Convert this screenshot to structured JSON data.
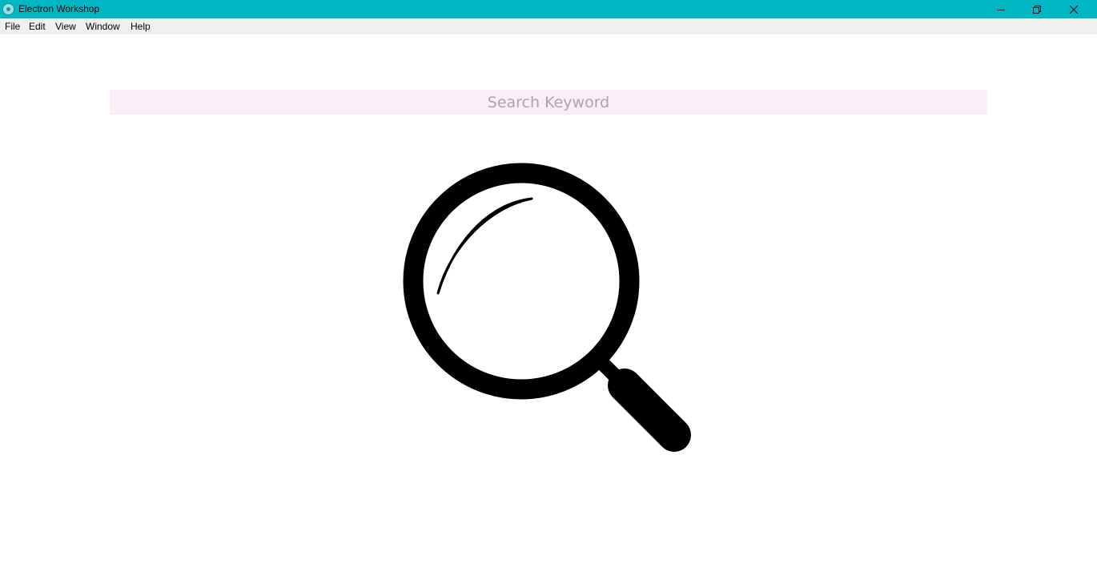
{
  "window": {
    "title": "Electron Workshop",
    "title_bar_color": "#00b7c3",
    "controls": [
      "minimize-icon",
      "restore-icon",
      "close-icon"
    ]
  },
  "menu": {
    "items": [
      {
        "label": "File"
      },
      {
        "label": "Edit"
      },
      {
        "label": "View"
      },
      {
        "label": "Window"
      },
      {
        "label": "Help"
      }
    ]
  },
  "search": {
    "placeholder": "Search Keyword",
    "value": "",
    "background": "#fbeef9"
  },
  "illustration": {
    "icon": "magnifying-glass-icon"
  }
}
